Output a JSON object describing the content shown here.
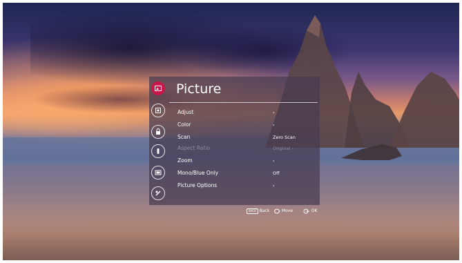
{
  "menu": {
    "title": "Picture",
    "items": [
      {
        "label": "Adjust",
        "value": "›"
      },
      {
        "label": "Color",
        "value": "›"
      },
      {
        "label": "Scan",
        "value": "Zero Scan"
      },
      {
        "label": "Aspect Ratio",
        "value": "Original ›",
        "disabled": true
      },
      {
        "label": "Zoom",
        "value": "›"
      },
      {
        "label": "Mono/Blue Only",
        "value": "Off"
      },
      {
        "label": "Picture Options",
        "value": "›"
      }
    ],
    "side_icons": [
      "picture-icon",
      "setup-icon",
      "lock-icon",
      "remote-icon",
      "input-icon",
      "support-icon"
    ]
  },
  "footer": {
    "back_key": "BACK",
    "back_label": "Back",
    "move_label": "Move",
    "ok_label": "OK"
  },
  "colors": {
    "accent": "#c8174a",
    "panel": "#46394f"
  }
}
